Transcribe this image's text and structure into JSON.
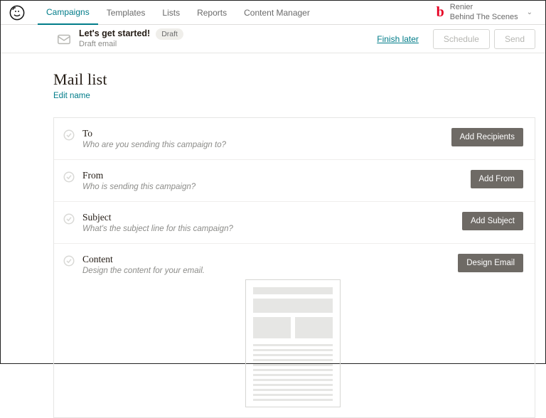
{
  "nav": {
    "items": [
      "Campaigns",
      "Templates",
      "Lists",
      "Reports",
      "Content Manager"
    ],
    "active_index": 0
  },
  "account": {
    "name": "Renier",
    "org": "Behind The Scenes"
  },
  "subbar": {
    "title": "Let's get started!",
    "badge": "Draft",
    "desc": "Draft email",
    "finish": "Finish later",
    "schedule": "Schedule",
    "send": "Send"
  },
  "page": {
    "title": "Mail list",
    "edit": "Edit name"
  },
  "steps": [
    {
      "title": "To",
      "desc": "Who are you sending this campaign to?",
      "button": "Add Recipients"
    },
    {
      "title": "From",
      "desc": "Who is sending this campaign?",
      "button": "Add From"
    },
    {
      "title": "Subject",
      "desc": "What's the subject line for this campaign?",
      "button": "Add Subject"
    },
    {
      "title": "Content",
      "desc": "Design the content for your email.",
      "button": "Design Email"
    }
  ]
}
